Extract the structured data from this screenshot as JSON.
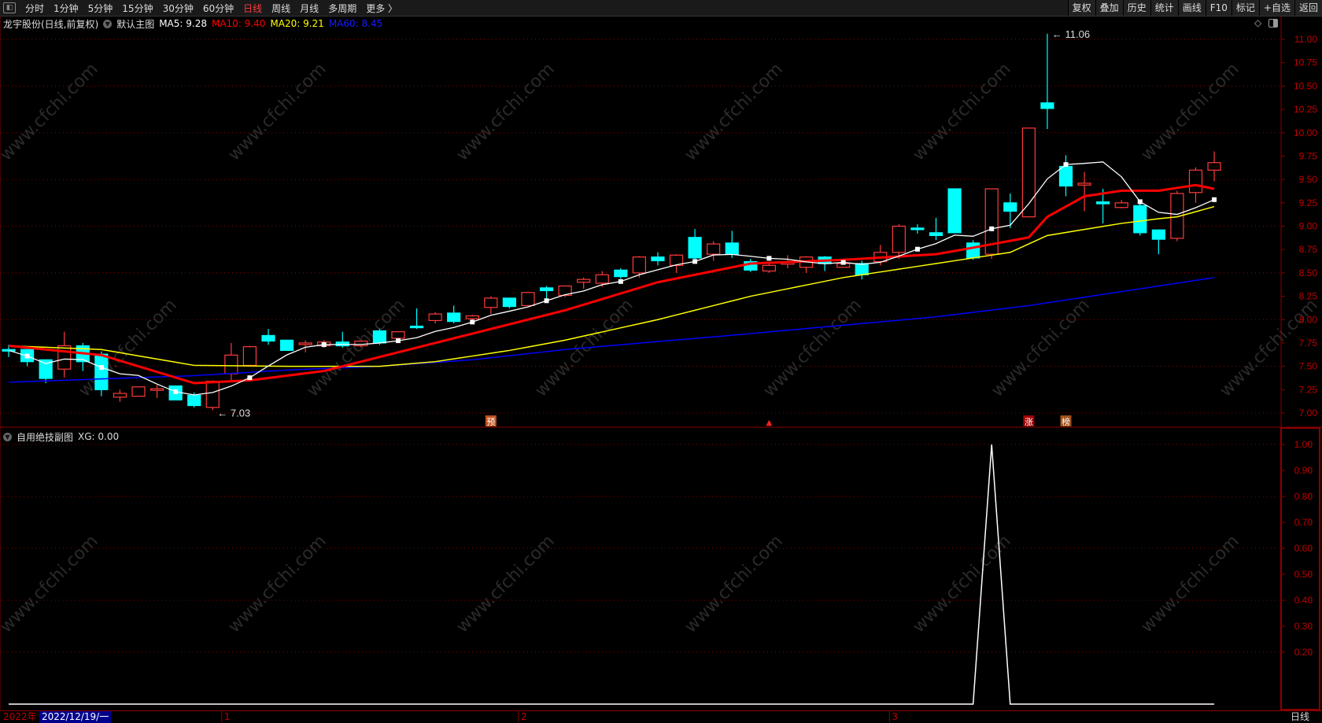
{
  "toolbar": {
    "left_items": [
      "分时",
      "1分钟",
      "5分钟",
      "15分钟",
      "30分钟",
      "60分钟",
      "日线",
      "周线",
      "月线",
      "多周期",
      "更多 〉"
    ],
    "active": "日线",
    "right_items": [
      "复权",
      "叠加",
      "历史",
      "统计",
      "画线",
      "F10",
      "标记",
      "+自选",
      "返回"
    ]
  },
  "info": {
    "stock": "龙宇股份(日线,前复权)",
    "template": "默认主图",
    "ma5": "MA5: 9.28",
    "ma10": "MA10: 9.40",
    "ma20": "MA20: 9.21",
    "ma60": "MA60: 8.45"
  },
  "sub_info": {
    "title": "自用绝技副图",
    "xg": "XG: 0.00"
  },
  "datebar": {
    "year": "2022年",
    "cursor_date": "2022/12/19/一",
    "months": [
      "1",
      "2",
      "3"
    ]
  },
  "period_label": "日线",
  "watermark": "www.cfchi.com",
  "colors": {
    "up": "#ff3b3b",
    "down": "#00ffff",
    "ma5": "#ffffff",
    "ma10": "#ff0000",
    "ma20": "#ffff00",
    "ma60": "#0000ff",
    "axis": "#8b0000"
  },
  "chart_data": [
    {
      "type": "candlestick",
      "title": "龙宇股份 日线",
      "ylim": [
        7.0,
        11.0
      ],
      "yticks": [
        "11.00",
        "10.75",
        "10.50",
        "10.25",
        "10.00",
        "9.75",
        "9.50",
        "9.25",
        "9.00",
        "8.75",
        "8.50",
        "8.25",
        "8.00",
        "7.75",
        "7.50",
        "7.25",
        "7.00"
      ],
      "annotations": {
        "high": {
          "index": 56,
          "label": "11.06"
        },
        "low": {
          "index": 11,
          "label": "7.03"
        }
      },
      "markers": [
        {
          "index": 26,
          "label": "预",
          "color": "#c0501a"
        },
        {
          "index": 41,
          "label": "▲",
          "color": "#ff2020"
        },
        {
          "index": 55,
          "label": "涨",
          "color": "#a00000"
        },
        {
          "index": 57,
          "label": "榜",
          "color": "#a0501a"
        }
      ],
      "month_starts": [
        {
          "index": 12,
          "label": "1"
        },
        {
          "index": 28,
          "label": "2"
        },
        {
          "index": 48,
          "label": "3"
        }
      ],
      "ohlc": [
        [
          7.68,
          7.73,
          7.6,
          7.67
        ],
        [
          7.68,
          7.68,
          7.5,
          7.55
        ],
        [
          7.57,
          7.57,
          7.32,
          7.37
        ],
        [
          7.47,
          7.87,
          7.38,
          7.72
        ],
        [
          7.72,
          7.75,
          7.45,
          7.55
        ],
        [
          7.63,
          7.66,
          7.18,
          7.25
        ],
        [
          7.17,
          7.25,
          7.12,
          7.21
        ],
        [
          7.18,
          7.28,
          7.18,
          7.28
        ],
        [
          7.25,
          7.3,
          7.16,
          7.26
        ],
        [
          7.29,
          7.29,
          7.14,
          7.14
        ],
        [
          7.19,
          7.22,
          7.06,
          7.08
        ],
        [
          7.06,
          7.35,
          7.03,
          7.34
        ],
        [
          7.42,
          7.75,
          7.34,
          7.62
        ],
        [
          7.51,
          7.72,
          7.51,
          7.71
        ],
        [
          7.83,
          7.9,
          7.73,
          7.77
        ],
        [
          7.78,
          7.78,
          7.67,
          7.67
        ],
        [
          7.74,
          7.78,
          7.65,
          7.75
        ],
        [
          7.72,
          7.78,
          7.7,
          7.76
        ],
        [
          7.76,
          7.87,
          7.7,
          7.72
        ],
        [
          7.72,
          7.77,
          7.7,
          7.77
        ],
        [
          7.88,
          7.9,
          7.73,
          7.75
        ],
        [
          7.8,
          7.87,
          7.76,
          7.87
        ],
        [
          7.93,
          8.12,
          7.9,
          7.92
        ],
        [
          7.99,
          8.08,
          7.96,
          8.06
        ],
        [
          8.07,
          8.15,
          7.96,
          7.98
        ],
        [
          8.01,
          8.05,
          8.0,
          8.04
        ],
        [
          8.13,
          8.25,
          8.06,
          8.23
        ],
        [
          8.23,
          8.23,
          8.12,
          8.14
        ],
        [
          8.15,
          8.3,
          8.15,
          8.29
        ],
        [
          8.34,
          8.36,
          8.19,
          8.31
        ],
        [
          8.26,
          8.36,
          8.24,
          8.36
        ],
        [
          8.4,
          8.45,
          8.33,
          8.43
        ],
        [
          8.39,
          8.52,
          8.35,
          8.48
        ],
        [
          8.53,
          8.55,
          8.44,
          8.46
        ],
        [
          8.5,
          8.68,
          8.45,
          8.67
        ],
        [
          8.67,
          8.72,
          8.58,
          8.63
        ],
        [
          8.58,
          8.7,
          8.5,
          8.69
        ],
        [
          8.88,
          8.97,
          8.64,
          8.66
        ],
        [
          8.7,
          8.84,
          8.63,
          8.81
        ],
        [
          8.82,
          8.95,
          8.66,
          8.7
        ],
        [
          8.62,
          8.65,
          8.51,
          8.53
        ],
        [
          8.52,
          8.6,
          8.5,
          8.58
        ],
        [
          8.6,
          8.69,
          8.55,
          8.61
        ],
        [
          8.56,
          8.68,
          8.5,
          8.67
        ],
        [
          8.67,
          8.68,
          8.52,
          8.6
        ],
        [
          8.56,
          8.62,
          8.56,
          8.6
        ],
        [
          8.6,
          8.63,
          8.43,
          8.48
        ],
        [
          8.62,
          8.8,
          8.58,
          8.72
        ],
        [
          8.72,
          9.02,
          8.65,
          9.0
        ],
        [
          8.98,
          9.02,
          8.92,
          8.97
        ],
        [
          8.93,
          9.09,
          8.85,
          8.9
        ],
        [
          9.4,
          9.4,
          8.93,
          8.93
        ],
        [
          8.82,
          8.85,
          8.64,
          8.66
        ],
        [
          8.7,
          9.4,
          8.65,
          9.4
        ],
        [
          9.25,
          9.35,
          8.98,
          9.16
        ],
        [
          9.1,
          10.05,
          9.1,
          10.05
        ],
        [
          10.32,
          11.06,
          10.04,
          10.26
        ],
        [
          9.64,
          9.76,
          9.32,
          9.43
        ],
        [
          9.44,
          9.58,
          9.16,
          9.46
        ],
        [
          9.26,
          9.4,
          9.03,
          9.24
        ],
        [
          9.2,
          9.28,
          9.19,
          9.25
        ],
        [
          9.22,
          9.25,
          8.9,
          8.93
        ],
        [
          8.96,
          8.96,
          8.7,
          8.86
        ],
        [
          8.87,
          9.38,
          8.84,
          9.35
        ],
        [
          9.36,
          9.63,
          9.25,
          9.6
        ],
        [
          9.6,
          9.8,
          9.48,
          9.68
        ]
      ],
      "ma10_points": [
        [
          0,
          7.72
        ],
        [
          5,
          7.62
        ],
        [
          10,
          7.32
        ],
        [
          13,
          7.35
        ],
        [
          17,
          7.45
        ],
        [
          20,
          7.6
        ],
        [
          25,
          7.85
        ],
        [
          30,
          8.1
        ],
        [
          35,
          8.4
        ],
        [
          40,
          8.6
        ],
        [
          45,
          8.64
        ],
        [
          50,
          8.7
        ],
        [
          52,
          8.77
        ],
        [
          55,
          8.88
        ],
        [
          56,
          9.1
        ],
        [
          58,
          9.32
        ],
        [
          60,
          9.38
        ],
        [
          62,
          9.38
        ],
        [
          64,
          9.44
        ],
        [
          65,
          9.4
        ]
      ],
      "ma20_points": [
        [
          0,
          7.72
        ],
        [
          5,
          7.68
        ],
        [
          10,
          7.51
        ],
        [
          15,
          7.5
        ],
        [
          20,
          7.5
        ],
        [
          23,
          7.55
        ],
        [
          27,
          7.67
        ],
        [
          30,
          7.78
        ],
        [
          35,
          8.0
        ],
        [
          40,
          8.25
        ],
        [
          45,
          8.45
        ],
        [
          50,
          8.6
        ],
        [
          54,
          8.72
        ],
        [
          56,
          8.9
        ],
        [
          60,
          9.03
        ],
        [
          62,
          9.08
        ],
        [
          63,
          9.1
        ],
        [
          65,
          9.21
        ]
      ],
      "ma60_points": [
        [
          0,
          7.33
        ],
        [
          10,
          7.4
        ],
        [
          15,
          7.46
        ],
        [
          20,
          7.5
        ],
        [
          25,
          7.57
        ],
        [
          30,
          7.68
        ],
        [
          40,
          7.85
        ],
        [
          50,
          8.03
        ],
        [
          55,
          8.15
        ],
        [
          60,
          8.3
        ],
        [
          65,
          8.45
        ]
      ]
    },
    {
      "type": "line",
      "title": "自用绝技副图",
      "series": [
        {
          "name": "XG",
          "spike_index": 53,
          "values_default": 0,
          "spike_value": 1
        }
      ],
      "count": 66,
      "ylim": [
        0,
        1.0
      ],
      "yticks": [
        "1.00",
        "0.90",
        "0.80",
        "0.70",
        "0.60",
        "0.50",
        "0.40",
        "0.30",
        "0.20"
      ]
    }
  ]
}
